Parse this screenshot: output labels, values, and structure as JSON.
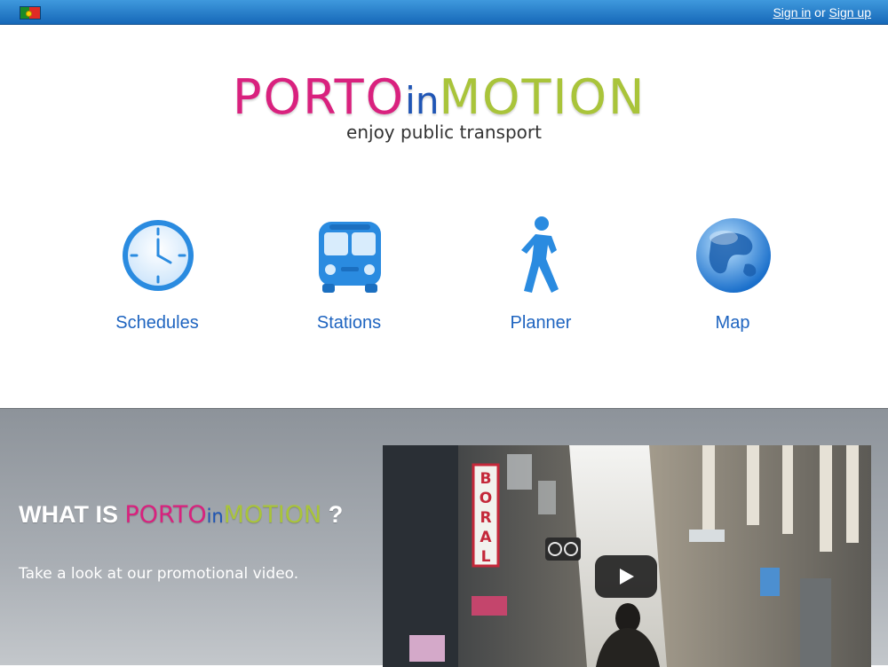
{
  "topbar": {
    "sign_in": "Sign in",
    "or": "or",
    "sign_up": "Sign up"
  },
  "logo": {
    "porto": "PORTO",
    "in": "in",
    "motion": "MOTION",
    "tagline": "enjoy public transport"
  },
  "menu": [
    {
      "label": "Schedules",
      "icon": "clock-icon"
    },
    {
      "label": "Stations",
      "icon": "bus-icon"
    },
    {
      "label": "Planner",
      "icon": "walking-person-icon"
    },
    {
      "label": "Map",
      "icon": "globe-icon"
    }
  ],
  "promo": {
    "what_is": "WHAT IS",
    "question_mark": "?",
    "text": "Take a look at our promotional video.",
    "video_sign": "BORAL"
  },
  "colors": {
    "brand_pink": "#d9217e",
    "brand_blue": "#1f55b5",
    "brand_green": "#a9c43a",
    "link_blue": "#1e64c0",
    "topbar_blue": "#1668b8"
  }
}
